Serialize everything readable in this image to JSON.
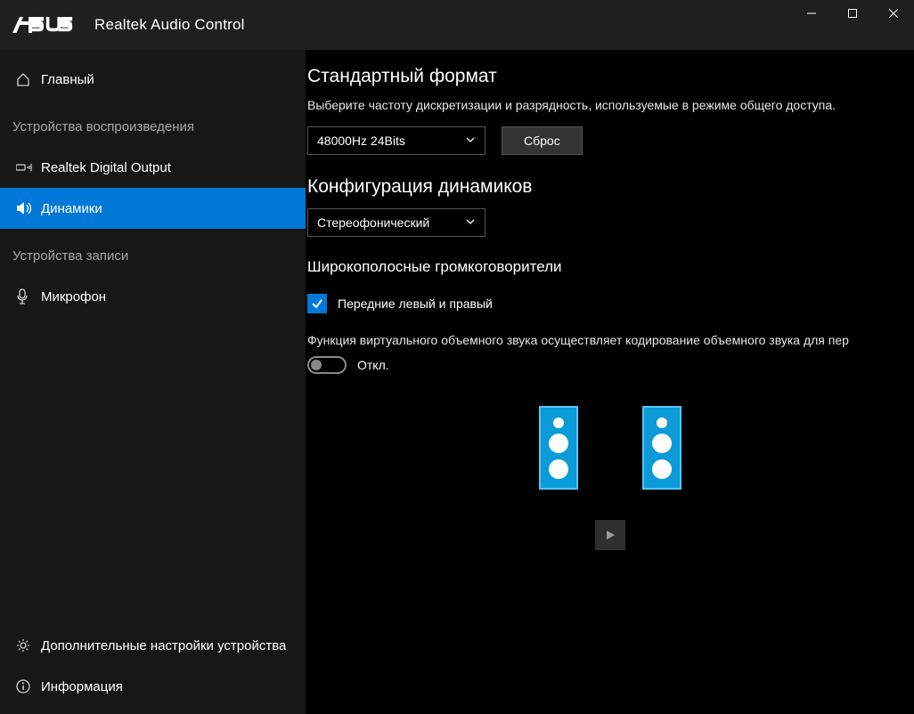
{
  "titlebar": {
    "app_title": "Realtek Audio Control"
  },
  "sidebar": {
    "main": "Главный",
    "playback_heading": "Устройства воспроизведения",
    "playback_items": [
      "Realtek Digital Output",
      "Динамики"
    ],
    "active_playback_index": 1,
    "record_heading": "Устройства записи",
    "record_items": [
      "Микрофон"
    ],
    "advanced": "Дополнительные настройки устройства",
    "info": "Информация"
  },
  "content": {
    "format": {
      "title": "Стандартный формат",
      "subtitle": "Выберите частоту дискретизации и разрядность, используемые в режиме общего доступа.",
      "selected": "48000Hz 24Bits",
      "reset_label": "Сброс"
    },
    "speaker_config": {
      "title": "Конфигурация динамиков",
      "selected": "Стереофонический"
    },
    "fullrange": {
      "title": "Широкополосные громкоговорители",
      "front_label": "Передние левый и правый",
      "front_checked": true
    },
    "virtual": {
      "description": "Функция виртуального объемного звука осуществляет кодирование объемного звука для пер",
      "toggle_label": "Откл.",
      "enabled": false
    }
  },
  "colors": {
    "accent": "#0078d7",
    "speaker": "#0a9bd8"
  }
}
